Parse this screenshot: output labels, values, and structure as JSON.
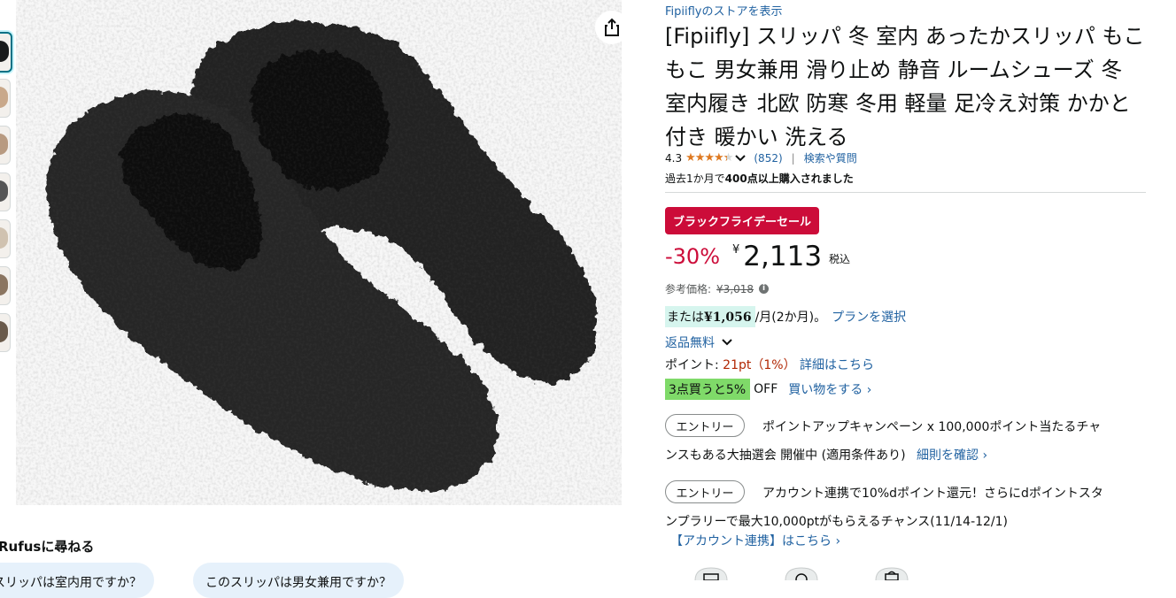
{
  "thumbnails": [
    {
      "name": "thumb-1",
      "color": "#1a1a1a",
      "active": true
    },
    {
      "name": "thumb-2",
      "color": "#c9a88a",
      "active": false
    },
    {
      "name": "thumb-3",
      "color": "#b89a80",
      "active": false
    },
    {
      "name": "thumb-4",
      "color": "#555555",
      "active": false
    },
    {
      "name": "thumb-5",
      "color": "#d0c2b0",
      "active": false
    },
    {
      "name": "thumb-6",
      "color": "#8b7560",
      "active": false
    },
    {
      "name": "thumb-7",
      "color": "#6a5a4a",
      "active": false
    }
  ],
  "rufus": {
    "title": "Rufusに尋ねる",
    "chips": [
      "このスリッパは室内用ですか？",
      "このスリッパは男女兼用ですか？"
    ]
  },
  "product": {
    "store_link": "Fipiiflyのストアを表示",
    "title": "[Fipiifly] スリッパ 冬 室内 あったかスリッパ もこもこ 男女兼用 滑り止め 静音 ルームシューズ 冬 室内履き 北欧 防寒 冬用 軽量 足冷え対策 かかと付き 暖かい 洗える",
    "rating": "4.3",
    "rating_stars": 4.3,
    "review_count": "(852)",
    "search_qa": "検索や質問",
    "bought_prefix": "過去1か月で",
    "bought_bold": "400点以上購入されました"
  },
  "pricing": {
    "deal_badge": "ブラックフライデーセール",
    "discount": "-30%",
    "currency": "¥",
    "price": "2,113",
    "tax_label": "税込",
    "list_price_label": "参考価格:",
    "list_price": "¥3,018",
    "installment_prefix": "または",
    "installment_amount": "¥1,056",
    "installment_suffix": "/月(2か月)。",
    "installment_link": "プランを選択",
    "returns": "返品無料",
    "points_label": "ポイント:",
    "points_value": "21pt（1%）",
    "points_link": "詳細はこちら",
    "promo_badge": "3点買うと5%",
    "promo_off": "OFF",
    "promo_link": "買い物をする ›"
  },
  "campaigns": [
    {
      "entry_label": "エントリー",
      "line1": "ポイントアップキャンペーン x 100,000ポイント当たるチャ",
      "line2": "ンスもある大抽選会 開催中 (適用条件あり)",
      "link": "細則を確認 ›"
    },
    {
      "entry_label": "エントリー",
      "line1": "アカウント連携で10%dポイント還元！さらにdポイントスタ",
      "line2": "ンプラリーで最大10,000ptがもらえるチャンス(11/14-12/1)",
      "link": "【アカウント連携】はこちら ›"
    }
  ],
  "colors": {
    "deal_red": "#cc0c39",
    "link_blue": "#2162a1",
    "star_orange": "#de7921",
    "promo_green": "#7fda69",
    "installment_bg": "#d6f5ee"
  }
}
